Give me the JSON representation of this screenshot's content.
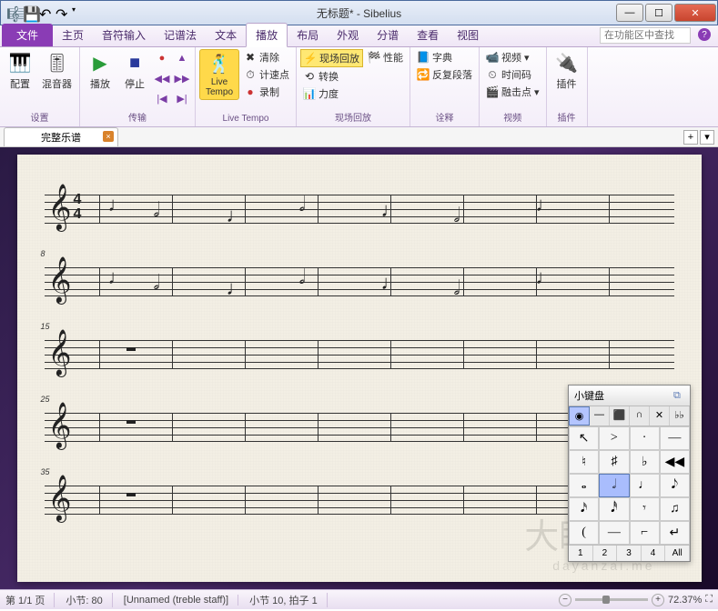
{
  "titlebar": {
    "title": "无标题* - Sibelius"
  },
  "tabs": {
    "file": "文件",
    "items": [
      "主页",
      "音符输入",
      "记谱法",
      "文本",
      "播放",
      "布局",
      "外观",
      "分谱",
      "查看",
      "视图"
    ],
    "active": "播放",
    "search_placeholder": "在功能区中查找"
  },
  "ribbon": {
    "setup": {
      "config": "配置",
      "mixer": "混音器",
      "label": "设置"
    },
    "transport": {
      "play": "播放",
      "stop": "停止",
      "label": "传输"
    },
    "live": {
      "btn": "Live\nTempo",
      "clear": "清除",
      "tap": "计速点",
      "record": "录制",
      "label": "Live Tempo"
    },
    "liveplay": {
      "header": "现场回放",
      "perf": "性能",
      "convert": "转换",
      "velocity": "力度",
      "label": "现场回放"
    },
    "interpret": {
      "dict": "字典",
      "repeat": "反复段落",
      "label": "诠释"
    },
    "video": {
      "header": "视频",
      "timecode": "时间码",
      "hitpoint": "融击点",
      "label": "视频"
    },
    "plugins": {
      "btn": "插件",
      "label": "插件"
    }
  },
  "doctab": {
    "name": "完整乐谱"
  },
  "keypad": {
    "title": "小键盘",
    "tabs": [
      "◉",
      "—",
      "⬛",
      "∩",
      "✕",
      "♭♭"
    ],
    "rows": [
      [
        "↖",
        ">",
        "·",
        "—"
      ],
      [
        "♮",
        "♯",
        "♭",
        "◀◀"
      ],
      [
        "𝅝",
        "𝅗𝅥",
        "♩",
        "𝅘𝅥𝅮"
      ],
      [
        "𝅘𝅥𝅯",
        "𝅘𝅥𝅰",
        "𝄾",
        "♫"
      ],
      [
        "(",
        "—",
        "⌐",
        "↵"
      ]
    ],
    "selected": [
      [
        2,
        1
      ]
    ],
    "bottom": [
      "1",
      "2",
      "3",
      "4",
      "All"
    ]
  },
  "staves": {
    "bar_numbers": [
      "",
      "8",
      "15",
      "25",
      "35"
    ],
    "timesig_top": "4",
    "timesig_bot": "4"
  },
  "status": {
    "page": "第 1/1 页",
    "bar": "小节: 80",
    "staff": "[Unnamed (treble staff)]",
    "pos": "小节 10, 拍子 1",
    "zoom": "72.37%"
  },
  "watermark": {
    "main": "大眼仔~旭",
    "sub": "dayanzai.me"
  }
}
